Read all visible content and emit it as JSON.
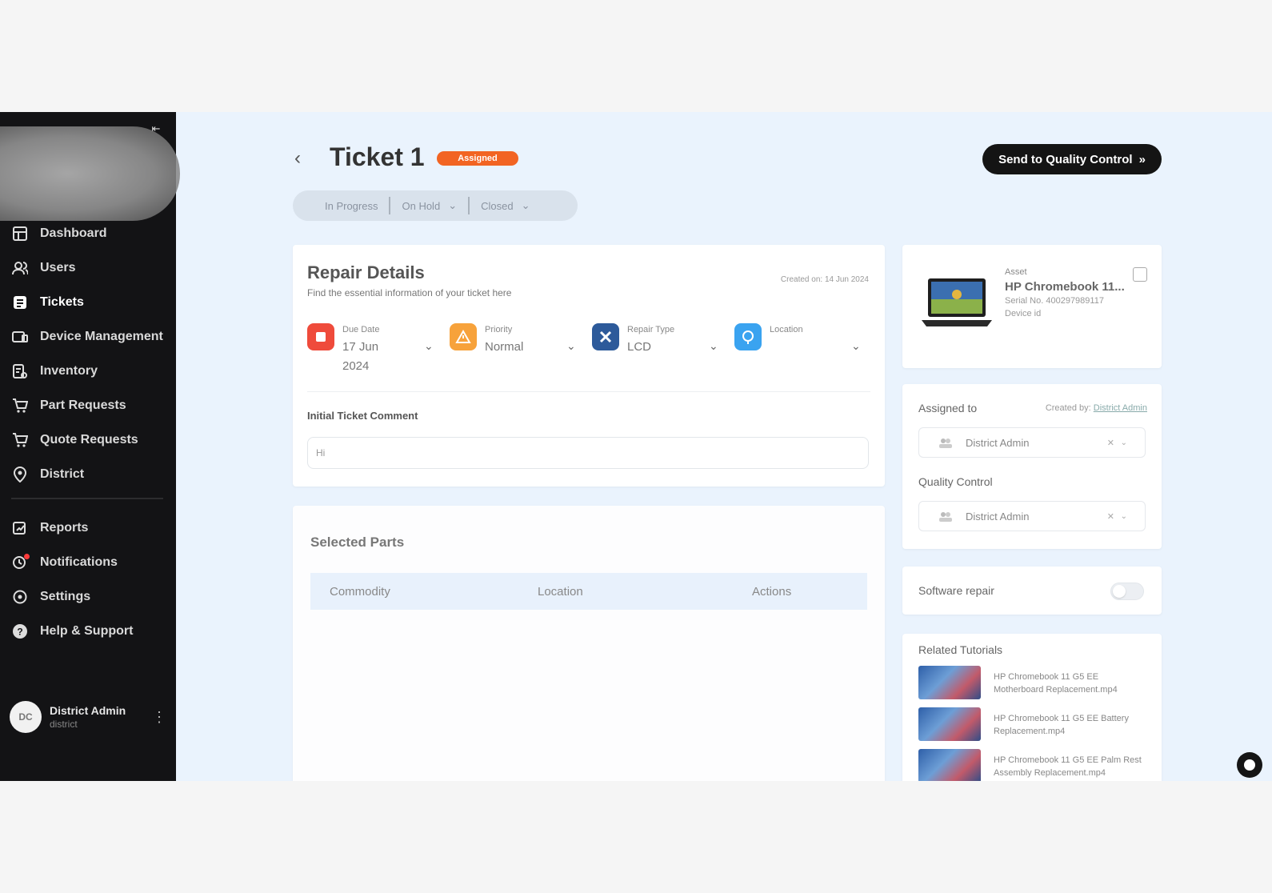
{
  "sidebar": {
    "collapse_icon": "collapse-left-icon",
    "items": [
      {
        "label": "Dashboard",
        "icon": "grid-icon",
        "active": false
      },
      {
        "label": "Users",
        "icon": "users-icon",
        "active": false
      },
      {
        "label": "Tickets",
        "icon": "ticket-icon",
        "active": true
      },
      {
        "label": "Device Management",
        "icon": "laptop-icon",
        "active": false
      },
      {
        "label": "Inventory",
        "icon": "inventory-icon",
        "active": false
      },
      {
        "label": "Part Requests",
        "icon": "cart-icon",
        "active": false
      },
      {
        "label": "Quote Requests",
        "icon": "cart-icon",
        "active": false
      },
      {
        "label": "District",
        "icon": "location-icon",
        "active": false
      }
    ],
    "secondary_items": [
      {
        "label": "Reports",
        "icon": "report-icon"
      },
      {
        "label": "Notifications",
        "icon": "bell-icon"
      },
      {
        "label": "Settings",
        "icon": "gear-icon"
      },
      {
        "label": "Help & Support",
        "icon": "help-icon"
      }
    ],
    "user": {
      "initials": "DC",
      "name": "District Admin",
      "sub": "district"
    }
  },
  "header": {
    "title": "Ticket 1",
    "status": "Assigned",
    "status_color": "#f26422",
    "send_button": "Send to Quality Control",
    "status_tabs": [
      {
        "label": "In Progress",
        "has_dropdown": false
      },
      {
        "label": "On Hold",
        "has_dropdown": true
      },
      {
        "label": "Closed",
        "has_dropdown": true
      }
    ]
  },
  "repair": {
    "title": "Repair Details",
    "subtitle": "Find the essential information of your ticket here",
    "created_on": "Created on: 14 Jun 2024",
    "fields": [
      {
        "label": "Due Date",
        "value": "17 Jun 2024",
        "icon": "calendar-icon",
        "color": "#ef4b3b"
      },
      {
        "label": "Priority",
        "value": "Normal",
        "icon": "warning-icon",
        "color": "#f7a23b"
      },
      {
        "label": "Repair Type",
        "value": "LCD",
        "icon": "tools-icon",
        "color": "#2d5a9a"
      },
      {
        "label": "Location",
        "value": "",
        "icon": "globe-icon",
        "color": "#3aa3f0"
      }
    ],
    "comment_label": "Initial Ticket Comment",
    "comment_value": "Hi"
  },
  "parts": {
    "title": "Selected Parts",
    "columns": [
      "Commodity",
      "Location",
      "Actions"
    ]
  },
  "asset": {
    "label": "Asset",
    "name": "HP Chromebook 11...",
    "serial": "Serial No. 400297989117",
    "device_id": "Device id"
  },
  "assign": {
    "title": "Assigned to",
    "created_by_label": "Created by:",
    "created_by_value": "District Admin",
    "assigned_value": "District Admin",
    "qc_title": "Quality Control",
    "qc_value": "District Admin"
  },
  "software": {
    "label": "Software repair",
    "enabled": false
  },
  "tutorials": {
    "title": "Related Tutorials",
    "items": [
      "HP Chromebook 11 G5 EE Motherboard Replacement.mp4",
      "HP Chromebook 11 G5 EE Battery Replacement.mp4",
      "HP Chromebook 11 G5 EE Palm Rest Assembly Replacement.mp4"
    ]
  }
}
